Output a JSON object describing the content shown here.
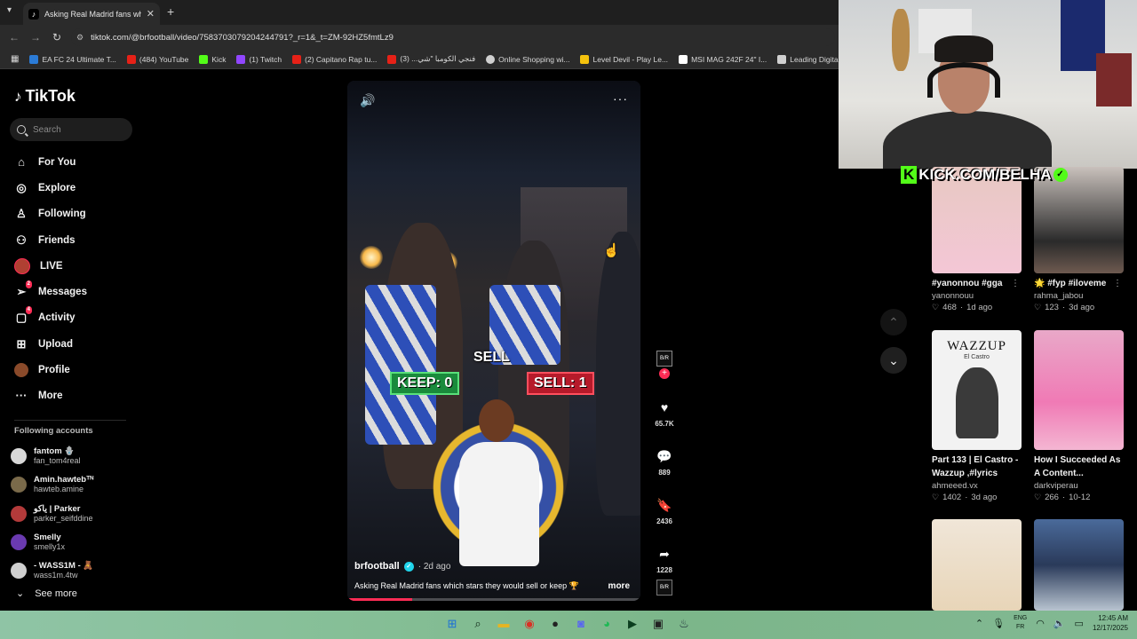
{
  "browser": {
    "tab_title": "Asking Real Madrid fans wh",
    "new_tab": "+",
    "url": "tiktok.com/@brfootball/video/7583703079204244791?_r=1&_t=ZM-92HZ5fmtLz9",
    "bookmarks": [
      {
        "label": "EA FC 24 Ultimate T...",
        "color": "#2b7bd6"
      },
      {
        "label": "(484) YouTube",
        "color": "#e62117"
      },
      {
        "label": "Kick",
        "color": "#53fc18"
      },
      {
        "label": "(1) Twitch",
        "color": "#9146ff"
      },
      {
        "label": "(2) Capitano Rap tu...",
        "color": "#e62117"
      },
      {
        "label": "فنجي الكومبا \"شي... (3)",
        "color": "#e62117"
      },
      {
        "label": "Online Shopping wi...",
        "color": "#d0d0d0"
      },
      {
        "label": "Level Devil - Play Le...",
        "color": "#f4c20d"
      },
      {
        "label": "MSI MAG 242F 24\" I...",
        "color": "#ffffff"
      },
      {
        "label": "Leading Digital Stor...",
        "color": "#d0d0d0"
      }
    ]
  },
  "sidebar": {
    "logo": "TikTok",
    "search_placeholder": "Search",
    "nav": [
      {
        "label": "For You",
        "icon": "home-icon"
      },
      {
        "label": "Explore",
        "icon": "compass-icon"
      },
      {
        "label": "Following",
        "icon": "following-icon"
      },
      {
        "label": "Friends",
        "icon": "friends-icon"
      },
      {
        "label": "LIVE",
        "icon": "live-avatar"
      },
      {
        "label": "Messages",
        "icon": "messages-icon",
        "badge": "2"
      },
      {
        "label": "Activity",
        "icon": "activity-icon",
        "badge": "4"
      },
      {
        "label": "Upload",
        "icon": "upload-icon"
      },
      {
        "label": "Profile",
        "icon": "profile-avatar"
      },
      {
        "label": "More",
        "icon": "more-icon"
      }
    ],
    "following_header": "Following accounts",
    "accounts": [
      {
        "name": "fantom 🪬",
        "handle": "fan_tom4real",
        "color": "#d8d8d8"
      },
      {
        "name": "Amin.hawtebᵀᴺ",
        "handle": "hawteb.amine",
        "color": "#7a6a4a"
      },
      {
        "name": "ياكو | Parker",
        "handle": "parker_seifddine",
        "color": "#b33a3a"
      },
      {
        "name": "Smelly",
        "handle": "smelly1x",
        "color": "#6a3ab0"
      },
      {
        "name": "- WASS1M - 🧸",
        "handle": "wass1m.4tw",
        "color": "#cfcfcf"
      }
    ],
    "see_more": "See more"
  },
  "video": {
    "author": "brfootball",
    "posted": "· 2d ago",
    "caption": "Asking Real Madrid fans which stars they would sell or keep 🏆",
    "more": "more",
    "overlay": {
      "sell_label": "SELL",
      "keep": "KEEP: 0",
      "sell": "SELL: 1"
    },
    "progress": 0.22
  },
  "actions": {
    "avatar_text": "B/R",
    "likes": "65.7K",
    "comments": "889",
    "saves": "2436",
    "shares": "1228"
  },
  "stream": {
    "kick_k": "K",
    "kick_text": "KICK.COM/BELHA"
  },
  "recommended": [
    {
      "title": "#yanonnou #gga",
      "user": "yanonnouu",
      "likes": "468",
      "age": "1d ago"
    },
    {
      "title": "🌟 #fyp #iloveme",
      "user": "rahma_jabou",
      "likes": "123",
      "age": "3d ago"
    },
    {
      "title": "Part 133 | El Castro - Wazzup ,#lyrics",
      "user": "ahmeeed.vx",
      "likes": "1402",
      "age": "3d ago"
    },
    {
      "title": "How I Succeeded As A Content...",
      "user": "darkviperau",
      "likes": "266",
      "age": "10-12"
    },
    {
      "title": "",
      "user": "",
      "likes": "",
      "age": ""
    },
    {
      "title": "",
      "user": "",
      "likes": "",
      "age": ""
    }
  ],
  "thumb_text": {
    "wazzup": "WAZZUP",
    "wazzup_sub": "El Castro"
  },
  "taskbar": {
    "lang_top": "ENG",
    "lang_bottom": "FR",
    "time": "12:45 AM",
    "date": "12/17/2025"
  }
}
